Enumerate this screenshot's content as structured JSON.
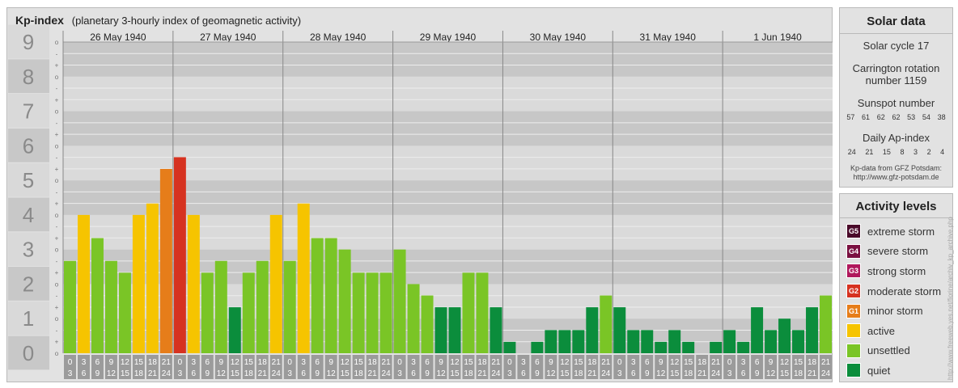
{
  "title": {
    "main": "Kp-index",
    "subtitle": "(planetary 3-hourly index of geomagnetic activity)"
  },
  "colors": {
    "quiet": "#0b8d3c",
    "unsettled": "#7ac526",
    "active": "#f6c400",
    "minor": "#e67d1a",
    "moderate": "#d63220",
    "strong": "#b0185c",
    "severe": "#7a1040",
    "extreme": "#4a0a2a",
    "band_dark": "#c7c7c7",
    "band_light": "#dadada",
    "tile": "#9b9b9b"
  },
  "chart_data": {
    "type": "bar",
    "ylim": [
      0,
      9
    ],
    "y_major_ticks": [
      "0",
      "1",
      "2",
      "3",
      "4",
      "5",
      "6",
      "7",
      "8",
      "9"
    ],
    "y_minor_ticks": [
      "o",
      "-",
      "+"
    ],
    "days": [
      "26 May 1940",
      "27 May 1940",
      "28 May 1940",
      "29 May 1940",
      "30 May 1940",
      "31 May 1940",
      "1 Jun 1940"
    ],
    "interval_starts": [
      "0",
      "3",
      "6",
      "9",
      "12",
      "15",
      "18",
      "21"
    ],
    "interval_ends": [
      "3",
      "6",
      "9",
      "12",
      "15",
      "18",
      "21",
      "24"
    ],
    "values": [
      [
        2.67,
        4.0,
        3.33,
        2.67,
        2.33,
        4.0,
        4.33,
        5.33
      ],
      [
        5.67,
        4.0,
        2.33,
        2.67,
        1.33,
        2.33,
        2.67,
        4.0
      ],
      [
        2.67,
        4.33,
        3.33,
        3.33,
        3.0,
        2.33,
        2.33,
        2.33
      ],
      [
        3.0,
        2.0,
        1.67,
        1.33,
        1.33,
        2.33,
        2.33,
        1.33
      ],
      [
        0.33,
        0.0,
        0.33,
        0.67,
        0.67,
        0.67,
        1.33,
        1.67
      ],
      [
        1.33,
        0.67,
        0.67,
        0.33,
        0.67,
        0.33,
        0.0,
        0.33
      ],
      [
        0.67,
        0.33,
        1.33,
        0.67,
        1.0,
        0.67,
        1.33,
        1.67
      ]
    ]
  },
  "solar": {
    "title": "Solar data",
    "cycle": "Solar cycle 17",
    "carrington_1": "Carrington rotation",
    "carrington_2": "number 1159",
    "sunspot_label": "Sunspot number",
    "sunspot_values": [
      "57",
      "61",
      "62",
      "62",
      "53",
      "54",
      "38"
    ],
    "ap_label": "Daily Ap-index",
    "ap_values": [
      "24",
      "21",
      "15",
      "8",
      "3",
      "2",
      "4"
    ],
    "credit_1": "Kp-data from GFZ Potsdam:",
    "credit_2": "http://www.gfz-potsdam.de"
  },
  "activity": {
    "title": "Activity levels",
    "levels": [
      {
        "badge": "G5",
        "label": "extreme storm",
        "color": "#4a0a2a"
      },
      {
        "badge": "G4",
        "label": "severe storm",
        "color": "#7a1040"
      },
      {
        "badge": "G3",
        "label": "strong storm",
        "color": "#b0185c"
      },
      {
        "badge": "G2",
        "label": "moderate storm",
        "color": "#d63220"
      },
      {
        "badge": "G1",
        "label": "minor storm",
        "color": "#e67d1a"
      },
      {
        "badge": "",
        "label": "active",
        "color": "#f6c400"
      },
      {
        "badge": "",
        "label": "unsettled",
        "color": "#7ac526"
      },
      {
        "badge": "",
        "label": "quiet",
        "color": "#0b8d3c"
      }
    ]
  },
  "watermark": "http://www.freeweb.yes.net/fiorine/archiv_kp_archive.php"
}
